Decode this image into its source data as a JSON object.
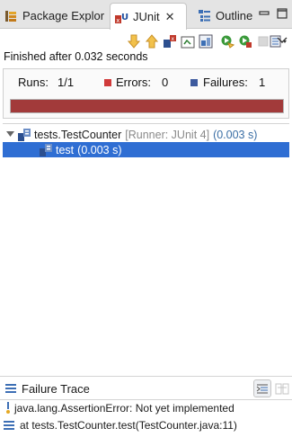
{
  "tabs": [
    {
      "label": "Package Explor",
      "icon": "package-explorer-icon",
      "active": false
    },
    {
      "label": "JUnit",
      "icon": "junit-icon",
      "active": true,
      "close": "✕"
    },
    {
      "label": "Outline",
      "icon": "outline-icon",
      "active": false
    }
  ],
  "window_controls": {
    "minimize": "minimize-icon",
    "maximize": "maximize-icon"
  },
  "toolbar": {
    "buttons": [
      "next-failure-icon",
      "previous-failure-icon",
      "show-failures-only-icon",
      "scroll-lock-icon",
      "test-run-history-icon",
      "rerun-test-icon",
      "rerun-failed-first-icon",
      "stop-icon",
      "layout-dropdown-icon",
      "view-menu-icon"
    ]
  },
  "status": "Finished after 0.032 seconds",
  "counters": {
    "runs_label": "Runs:",
    "runs_value": "1/1",
    "errors_label": "Errors:",
    "errors_value": "0",
    "failures_label": "Failures:",
    "failures_value": "1",
    "progress_fraction": 1.0,
    "colors": {
      "progress": "#a23a3a",
      "errors": "#d03a3a",
      "failures": "#3d5a9e"
    }
  },
  "tree": {
    "suite": {
      "name": "tests.TestCounter",
      "runner": "[Runner: JUnit 4]",
      "time": "(0.003 s)"
    },
    "tests": [
      {
        "name": "test",
        "time": "(0.003 s)",
        "selected": true
      }
    ]
  },
  "trace": {
    "title": "Failure Trace",
    "lines": [
      {
        "icon": "assertion-error-icon",
        "text": "java.lang.AssertionError: Not yet implemented"
      },
      {
        "icon": "stack-frame-icon",
        "text": "at tests.TestCounter.test(TestCounter.java:11)"
      }
    ]
  },
  "accent": "#2f6ed3"
}
